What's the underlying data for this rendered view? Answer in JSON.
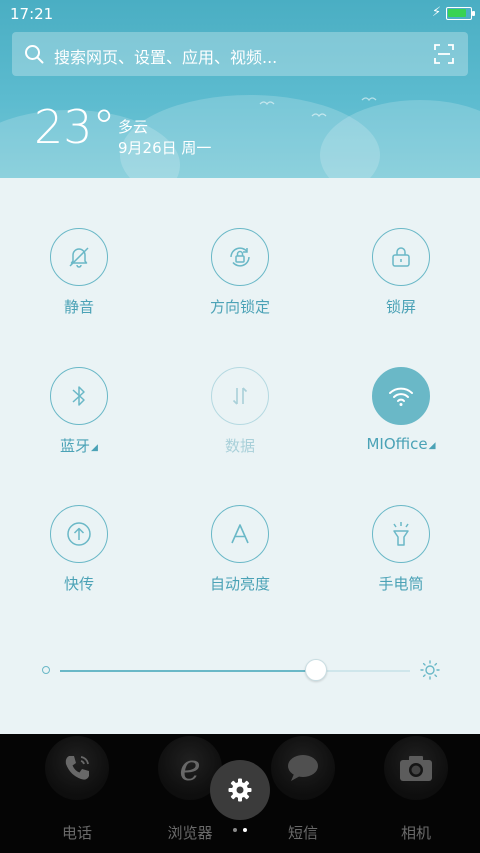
{
  "status_bar": {
    "time": "17:21",
    "battery_percent": 85,
    "charging": true
  },
  "search": {
    "placeholder": "搜索网页、设置、应用、视频..."
  },
  "weather": {
    "temperature": "23°",
    "condition": "多云",
    "date": "9月26日 周一"
  },
  "quick_toggles": [
    {
      "id": "mute",
      "label": "静音",
      "icon": "bell-off-icon",
      "state": "off"
    },
    {
      "id": "rotation-lock",
      "label": "方向锁定",
      "icon": "rotation-lock-icon",
      "state": "off"
    },
    {
      "id": "lock-screen",
      "label": "锁屏",
      "icon": "lock-icon",
      "state": "off"
    },
    {
      "id": "bluetooth",
      "label": "蓝牙",
      "icon": "bluetooth-icon",
      "state": "off",
      "expandable": true
    },
    {
      "id": "mobile-data",
      "label": "数据",
      "icon": "data-arrows-icon",
      "state": "disabled"
    },
    {
      "id": "wifi",
      "label": "MIOffice",
      "icon": "wifi-icon",
      "state": "on",
      "expandable": true
    },
    {
      "id": "quick-share",
      "label": "快传",
      "icon": "upload-circle-icon",
      "state": "off"
    },
    {
      "id": "auto-brightness",
      "label": "自动亮度",
      "icon": "letter-a-icon",
      "state": "off"
    },
    {
      "id": "flashlight",
      "label": "手电筒",
      "icon": "flashlight-icon",
      "state": "off"
    }
  ],
  "brightness": {
    "level_percent": 73
  },
  "dock": {
    "apps": [
      {
        "label": "电话",
        "icon": "phone-icon"
      },
      {
        "label": "浏览器",
        "icon": "browser-e-icon"
      },
      {
        "label": "短信",
        "icon": "message-bubble-icon"
      },
      {
        "label": "相机",
        "icon": "camera-icon"
      }
    ],
    "settings_icon": "gear-icon",
    "page_count": 2,
    "active_page": 1
  },
  "colors": {
    "accent": "#6ab8c7",
    "label": "#4ba2b6",
    "header": "#5cbbcf",
    "panel": "#eaf3f5"
  }
}
